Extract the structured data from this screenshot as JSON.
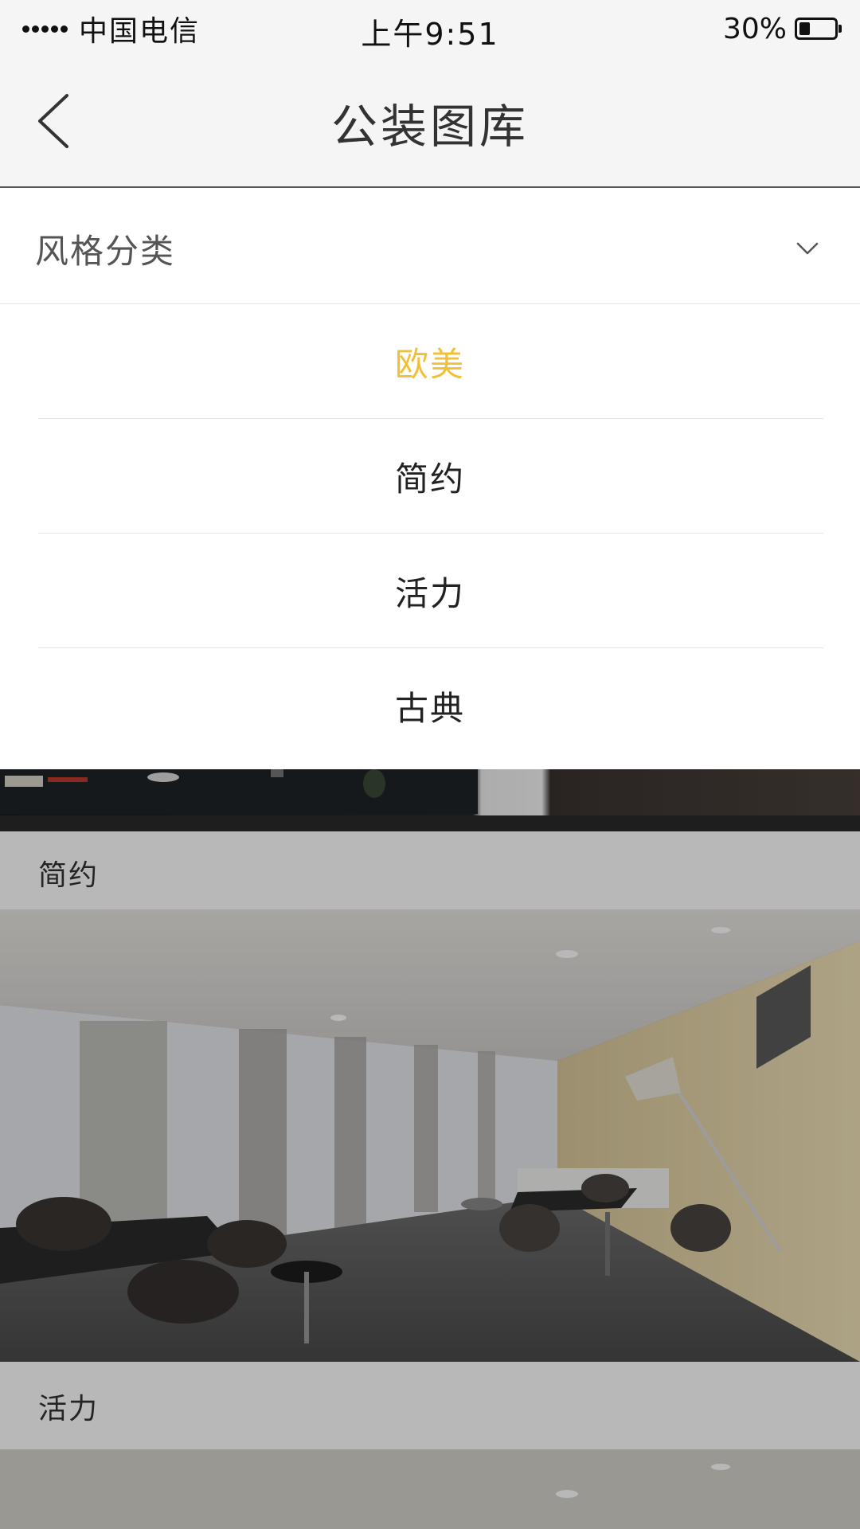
{
  "status_bar": {
    "carrier": "中国电信",
    "time": "上午9:51",
    "battery_percent": "30%",
    "battery_level": 0.3
  },
  "nav": {
    "title": "公装图库",
    "back_icon": "chevron-left-icon"
  },
  "filter": {
    "label": "风格分类",
    "icon": "chevron-down-icon",
    "expanded": true
  },
  "dropdown": {
    "selected_index": 0,
    "selected_color": "#f2c037",
    "options": [
      "欧美",
      "简约",
      "活力",
      "古典"
    ]
  },
  "gallery": {
    "sections": [
      {
        "title": "简约"
      },
      {
        "title": "活力"
      }
    ]
  }
}
